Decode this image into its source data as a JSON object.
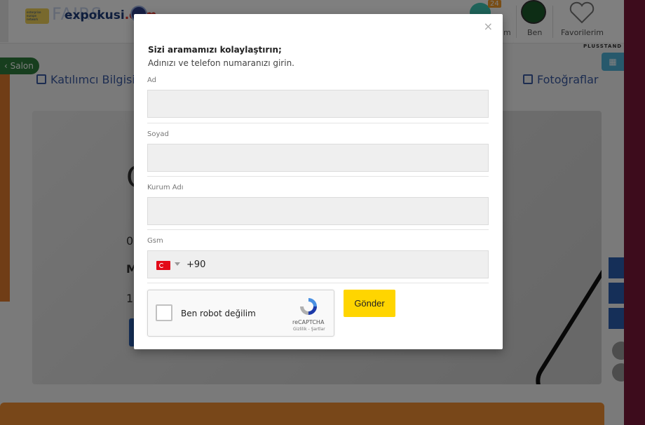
{
  "header": {
    "een_logo_text": "enterprise europe network",
    "fairs_logo_text": "FAIRS",
    "logo_name": "expokusi",
    "logo_tld": ".com",
    "chat_badge": "24",
    "profile_partial": "m",
    "profile_label": "Ben",
    "favorites_label": "Favorilerim",
    "plus_logo": "PLUSSTAND"
  },
  "sidebar": {
    "salon_label": "Salon"
  },
  "nav": {
    "participant_info": "Katılımcı Bilgisi",
    "photos": "Fotoğraflar"
  },
  "hero": {
    "ghost_1": "Ç",
    "ghost_2": "0",
    "ghost_3": "M",
    "ghost_4": "1"
  },
  "modal": {
    "close": "×",
    "title": "Sizi aramamızı kolaylaştırın;",
    "subtitle": "Adınızı ve telefon numaranızı girin.",
    "fields": [
      {
        "label": "Ad",
        "value": ""
      },
      {
        "label": "Soyad",
        "value": ""
      },
      {
        "label": "Kurum Adı",
        "value": ""
      },
      {
        "label": "Gsm",
        "value": ""
      }
    ],
    "country_flag": "turkey-flag",
    "dial_code": "+90",
    "recaptcha": {
      "label": "Ben robot değilim",
      "brand": "reCAPTCHA",
      "terms": "Gizlilik - Şartlar"
    },
    "submit_label": "Gönder"
  },
  "colors": {
    "accent_yellow": "#ffd500",
    "nav_blue": "#3a5aa3",
    "salon_green": "#2f7d3c",
    "bottom_orange": "#f08f33",
    "frame_maroon": "#7a1838"
  }
}
